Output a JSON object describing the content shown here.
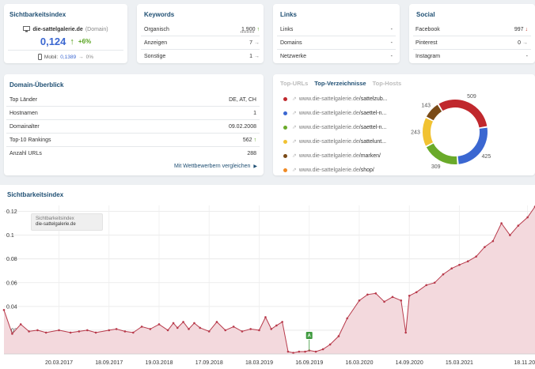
{
  "sichtbarkeit_card": {
    "title": "Sichtbarkeitsindex",
    "domain": "die-sattelgalerie.de",
    "domain_suffix": "(Domain)",
    "value": "0,124",
    "change": "+6%",
    "mobile_label": "Mobil:",
    "mobile_value": "0,1389",
    "mobile_change": "0%"
  },
  "keywords_card": {
    "title": "Keywords",
    "rows": [
      {
        "label": "Organisch",
        "value": "1.900",
        "trend": "up"
      },
      {
        "label": "Anzeigen",
        "value": "7",
        "trend": "flat"
      },
      {
        "label": "Sonstige",
        "value": "1",
        "trend": "flat"
      }
    ]
  },
  "links_card": {
    "title": "Links",
    "rows": [
      {
        "label": "Links",
        "value": "-"
      },
      {
        "label": "Domains",
        "value": "-"
      },
      {
        "label": "Netzwerke",
        "value": "-"
      }
    ]
  },
  "social_card": {
    "title": "Social",
    "rows": [
      {
        "label": "Facebook",
        "value": "997",
        "trend": "down"
      },
      {
        "label": "Pinterest",
        "value": "0",
        "trend": "flat"
      },
      {
        "label": "Instagram",
        "value": "-",
        "trend": ""
      }
    ]
  },
  "domain_card": {
    "title": "Domain-Überblick",
    "rows": [
      {
        "label": "Top Länder",
        "value": "DE, AT, CH",
        "trend": ""
      },
      {
        "label": "Hostnamen",
        "value": "1",
        "trend": ""
      },
      {
        "label": "Domainalter",
        "value": "09.02.2008",
        "trend": ""
      },
      {
        "label": "Top-10 Rankings",
        "value": "562",
        "trend": "up"
      },
      {
        "label": "Anzahl URLs",
        "value": "288",
        "trend": ""
      }
    ],
    "compare_link": "Mit Wettbewerbern vergleichen"
  },
  "directories_card": {
    "tabs": [
      "Top-URLs",
      "Top-Verzeichnisse",
      "Top-Hosts"
    ],
    "active_tab": 1,
    "items": [
      {
        "host": "www.die-sattelgalerie.de",
        "path": "/sattelzub...",
        "color": "#c0282d"
      },
      {
        "host": "www.die-sattelgalerie.de",
        "path": "/saettel-n...",
        "color": "#3b67d1"
      },
      {
        "host": "www.die-sattelgalerie.de",
        "path": "/saettel-n...",
        "color": "#6aaa2a"
      },
      {
        "host": "www.die-sattelgalerie.de",
        "path": "/sattelunt...",
        "color": "#f1c232"
      },
      {
        "host": "www.die-sattelgalerie.de",
        "path": "/marken/",
        "color": "#7a4a17"
      },
      {
        "host": "www.die-sattelgalerie.de",
        "path": "/shop/",
        "color": "#f08a24"
      }
    ],
    "donut": [
      {
        "label": "509",
        "value": 509,
        "color": "#c0282d"
      },
      {
        "label": "425",
        "value": 425,
        "color": "#3b67d1"
      },
      {
        "label": "309",
        "value": 309,
        "color": "#6aaa2a"
      },
      {
        "label": "243",
        "value": 243,
        "color": "#f1c232"
      },
      {
        "label": "143",
        "value": 143,
        "color": "#7a4a17"
      }
    ]
  },
  "chart_card": {
    "title": "Sichtbarkeitsindex",
    "tooltip_line1": "Sichtbarkeitsindex",
    "tooltip_line2": "die-sattelgalerie.de",
    "event_marker": "A",
    "colors": {
      "line": "#b83a4b",
      "fill": "#f3d9dd"
    }
  },
  "chart_data": {
    "type": "area",
    "series": [
      {
        "x": [
          "2016-09-01",
          "2016-10-01",
          "2016-11-01",
          "2016-12-01",
          "2017-01-01",
          "2017-02-01",
          "2017-03-20",
          "2017-05-01",
          "2017-06-01",
          "2017-07-01",
          "2017-08-01",
          "2017-09-18",
          "2017-10-15",
          "2017-11-15",
          "2017-12-15",
          "2018-01-15",
          "2018-02-15",
          "2018-03-19",
          "2018-04-20",
          "2018-05-10",
          "2018-05-25",
          "2018-06-15",
          "2018-07-05",
          "2018-07-25",
          "2018-08-15",
          "2018-09-17",
          "2018-10-15",
          "2018-11-15",
          "2018-12-15",
          "2019-01-15",
          "2019-02-15",
          "2019-03-18",
          "2019-04-10",
          "2019-05-01",
          "2019-05-20",
          "2019-06-10",
          "2019-07-01",
          "2019-07-20",
          "2019-08-10",
          "2019-09-01",
          "2019-09-16",
          "2019-10-10",
          "2019-11-05",
          "2019-12-01",
          "2020-01-01",
          "2020-02-01",
          "2020-03-16",
          "2020-04-15",
          "2020-05-15",
          "2020-06-15",
          "2020-07-15",
          "2020-08-15",
          "2020-09-01",
          "2020-09-14",
          "2020-10-10",
          "2020-11-15",
          "2020-12-15",
          "2021-01-15",
          "2021-02-15",
          "2021-03-15",
          "2021-04-15",
          "2021-05-15",
          "2021-06-15",
          "2021-07-15",
          "2021-08-15",
          "2021-09-15",
          "2021-10-15",
          "2021-11-18",
          "2021-12-15"
        ],
        "y": [
          0.037,
          0.017,
          0.025,
          0.019,
          0.02,
          0.018,
          0.02,
          0.018,
          0.019,
          0.02,
          0.018,
          0.02,
          0.021,
          0.019,
          0.018,
          0.023,
          0.021,
          0.025,
          0.02,
          0.026,
          0.022,
          0.027,
          0.021,
          0.026,
          0.022,
          0.019,
          0.027,
          0.02,
          0.023,
          0.019,
          0.021,
          0.02,
          0.031,
          0.021,
          0.024,
          0.027,
          0.002,
          0.001,
          0.002,
          0.002,
          0.003,
          0.002,
          0.004,
          0.008,
          0.015,
          0.03,
          0.045,
          0.05,
          0.051,
          0.044,
          0.048,
          0.045,
          0.018,
          0.049,
          0.052,
          0.058,
          0.06,
          0.067,
          0.072,
          0.075,
          0.078,
          0.082,
          0.09,
          0.095,
          0.11,
          0.1,
          0.108,
          0.115,
          0.124
        ]
      }
    ],
    "x_tick_labels": [
      "20.03.2017",
      "18.09.2017",
      "19.03.2018",
      "17.09.2018",
      "18.03.2019",
      "16.09.2019",
      "16.03.2020",
      "14.09.2020",
      "15.03.2021",
      "18.11.2021"
    ],
    "x_tick_dates": [
      "2017-03-20",
      "2017-09-18",
      "2018-03-19",
      "2018-09-17",
      "2019-03-18",
      "2019-09-16",
      "2020-03-16",
      "2020-09-14",
      "2021-03-15",
      "2021-11-18"
    ],
    "y_ticks": [
      0.02,
      0.04,
      0.06,
      0.08,
      0.1,
      0.12
    ],
    "y_tick_labels": [
      "0.02",
      "0.04",
      "0.06",
      "0.08",
      "0.1",
      "0.12"
    ],
    "ylim": [
      0,
      0.125
    ],
    "xlim": [
      "2016-09-01",
      "2021-12-15"
    ],
    "event_date": "2019-09-16",
    "grid": true
  }
}
